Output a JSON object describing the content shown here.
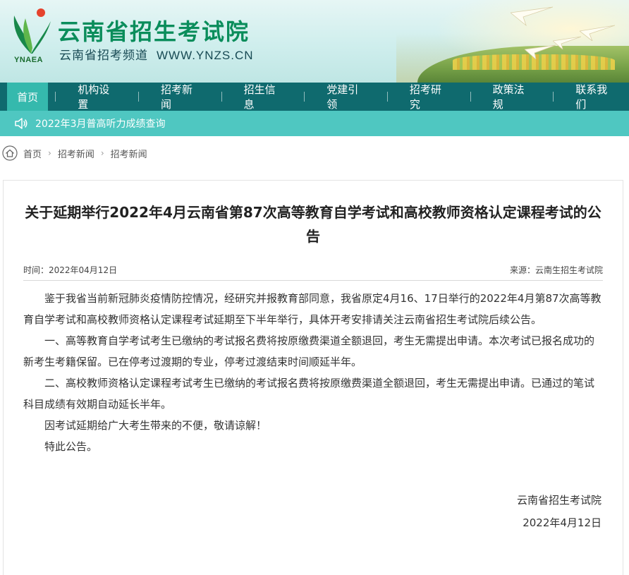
{
  "header": {
    "logo_text": "YNAEA",
    "title": "云南省招生考试院",
    "subtitle": "云南省招考频道",
    "url": "WWW.YNZS.CN"
  },
  "nav": {
    "items": [
      {
        "label": "首页",
        "active": true
      },
      {
        "label": "机构设置"
      },
      {
        "label": "招考新闻"
      },
      {
        "label": "招生信息"
      },
      {
        "label": "党建引领"
      },
      {
        "label": "招考研究"
      },
      {
        "label": "政策法规"
      },
      {
        "label": "联系我们"
      }
    ]
  },
  "ticker": {
    "icon": "speaker-icon",
    "text": "2022年3月普高听力成绩查询"
  },
  "breadcrumb": {
    "icon": "home-icon",
    "items": [
      "首页",
      "招考新闻",
      "招考新闻"
    ]
  },
  "article": {
    "title": "关于延期举行2022年4月云南省第87次高等教育自学考试和高校教师资格认定课程考试的公告",
    "time": "时间：2022年04月12日",
    "source": "来源：云南生招生考试院",
    "paragraphs": [
      "鉴于我省当前新冠肺炎疫情防控情况，经研究并报教育部同意，我省原定4月16、17日举行的2022年4月第87次高等教育自学考试和高校教师资格认定课程考试延期至下半年举行，具体开考安排请关注云南省招生考试院后续公告。",
      "一、高等教育自学考试考生已缴纳的考试报名费将按原缴费渠道全额退回，考生无需提出申请。本次考试已报名成功的新考生考籍保留。已在停考过渡期的专业，停考过渡结束时间顺延半年。",
      "二、高校教师资格认定课程考试考生已缴纳的考试报名费将按原缴费渠道全额退回，考生无需提出申请。已通过的笔试科目成绩有效期自动延长半年。",
      "因考试延期给广大考生带来的不便，敬请谅解！",
      "特此公告。"
    ],
    "signature_org": "云南省招生考试院",
    "signature_date": "2022年4月12日"
  },
  "colors": {
    "brand_green": "#0a8d5b",
    "nav_bg": "#0f6a6e",
    "nav_active": "#35b9ad",
    "ticker_bg": "#4fc7c1"
  }
}
